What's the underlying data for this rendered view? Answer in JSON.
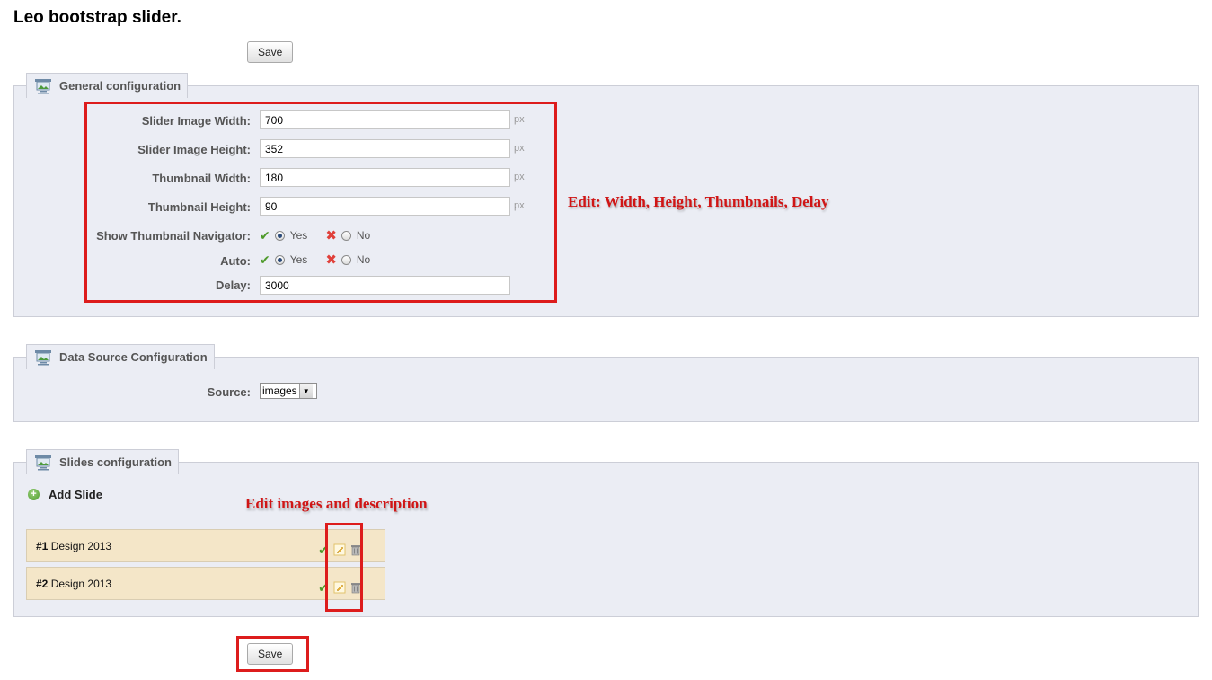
{
  "page": {
    "title": "Leo bootstrap slider."
  },
  "buttons": {
    "save_top": "Save",
    "save_bottom": "Save"
  },
  "general": {
    "legend": "General configuration",
    "fields": [
      {
        "label": "Slider Image Width:",
        "value": "700",
        "unit": "px"
      },
      {
        "label": "Slider Image Height:",
        "value": "352",
        "unit": "px"
      },
      {
        "label": "Thumbnail Width:",
        "value": "180",
        "unit": "px"
      },
      {
        "label": "Thumbnail Height:",
        "value": "90",
        "unit": "px"
      }
    ],
    "radios": [
      {
        "label": "Show Thumbnail Navigator:",
        "yes": "Yes",
        "no": "No",
        "selected": "Yes"
      },
      {
        "label": "Auto:",
        "yes": "Yes",
        "no": "No",
        "selected": "Yes"
      }
    ],
    "delay": {
      "label": "Delay:",
      "value": "3000"
    }
  },
  "datasource": {
    "legend": "Data Source Configuration",
    "source_label": "Source:",
    "source_value": "images"
  },
  "slides": {
    "legend": "Slides configuration",
    "add_label": "Add Slide",
    "items": [
      {
        "num": "#1",
        "name": "Design 2013"
      },
      {
        "num": "#2",
        "name": "Design 2013"
      }
    ]
  },
  "annotations": {
    "edit_general": "Edit: Width, Height, Thumbnails, Delay",
    "edit_images": "Edit images and description",
    "color": "#dd1c1c"
  },
  "icons": {
    "legend_icon": "image-config-icon",
    "check": "checkmark-icon",
    "cross": "cross-icon",
    "edit": "pencil-icon",
    "delete": "trash-icon",
    "add": "plus-circle-icon"
  }
}
